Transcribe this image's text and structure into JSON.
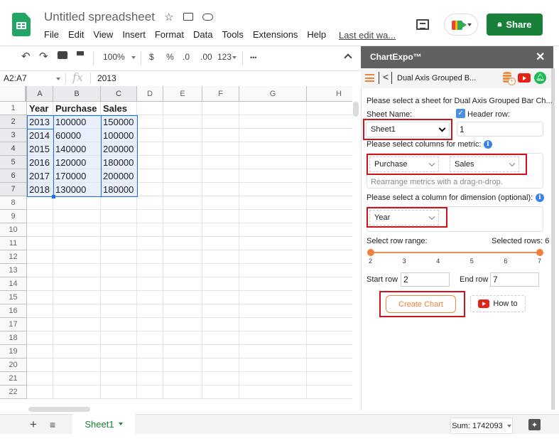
{
  "header": {
    "doc_title": "Untitled spreadsheet",
    "menu": [
      "File",
      "Edit",
      "View",
      "Insert",
      "Format",
      "Data",
      "Tools",
      "Extensions",
      "Help"
    ],
    "last_edit": "Last edit wa...",
    "share_label": "Share"
  },
  "toolbar": {
    "zoom": "100%",
    "currency": "$",
    "percent": "%",
    "dec_decrease": ".0",
    "dec_increase": ".00",
    "more_formats": "123",
    "more": "•••"
  },
  "formula_bar": {
    "name_box": "A2:A7",
    "fx": "fx",
    "value": "2013"
  },
  "grid": {
    "columns": [
      "A",
      "B",
      "C",
      "D",
      "E",
      "F",
      "G",
      "H"
    ],
    "row_numbers": [
      "1",
      "2",
      "3",
      "4",
      "5",
      "6",
      "7",
      "8",
      "9",
      "10",
      "11",
      "12",
      "13",
      "14",
      "15",
      "16",
      "17",
      "18",
      "19",
      "20",
      "21",
      "22"
    ],
    "rows": [
      [
        "Year",
        "Purchase",
        "Sales"
      ],
      [
        "2013",
        "100000",
        "150000"
      ],
      [
        "2014",
        "60000",
        "100000"
      ],
      [
        "2015",
        "140000",
        "200000"
      ],
      [
        "2016",
        "120000",
        "180000"
      ],
      [
        "2017",
        "170000",
        "200000"
      ],
      [
        "2018",
        "130000",
        "180000"
      ]
    ]
  },
  "bottom": {
    "sheet_tab": "Sheet1",
    "sum": "Sum: 1742093"
  },
  "panel": {
    "title": "ChartExpo™",
    "close": "✕",
    "nav_title": "Dual Axis Grouped B...",
    "sheet_prompt": "Please select a sheet for Dual Axis Grouped Bar Ch...",
    "sheet_name_label": "Sheet Name:",
    "sheet_name_value": "Sheet1",
    "header_row_label": "Header row:",
    "header_row_checked": true,
    "header_row_value": "1",
    "metric_prompt": "Please select columns for metric:",
    "metric_1": "Purchase",
    "metric_2": "Sales",
    "metric_hint": "Rearrange metrics with a drag-n-drop.",
    "dimension_prompt": "Please select a column for dimension (optional):",
    "dimension_value": "Year",
    "row_range_label": "Select row range:",
    "selected_rows": "Selected rows: 6",
    "range_ticks": [
      "2",
      "3",
      "4",
      "5",
      "6",
      "7"
    ],
    "range_start": 2,
    "range_end": 7,
    "start_row_label": "Start row",
    "start_row_value": "2",
    "end_row_label": "End row",
    "end_row_value": "7",
    "create_chart": "Create Chart",
    "how_to": "How to"
  },
  "colors": {
    "share_green": "#188038",
    "accent_orange": "#ef7f3a",
    "highlight_red": "#d0121a",
    "selection_blue": "#1a73e8"
  }
}
